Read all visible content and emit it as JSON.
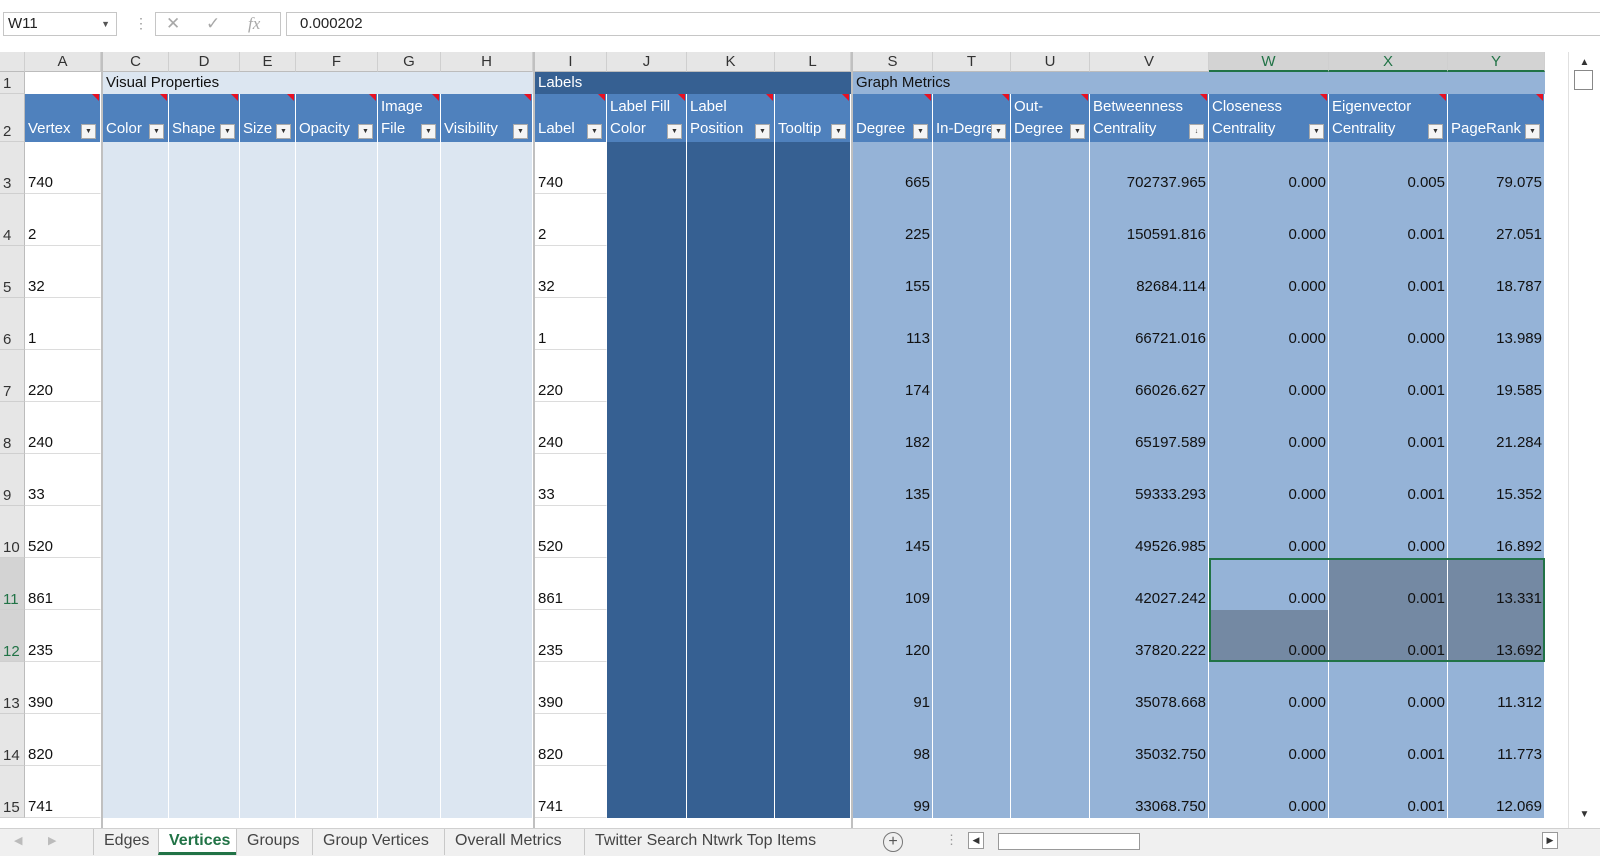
{
  "formula_bar": {
    "name_box": "W11",
    "cancel_icon": "✕",
    "enter_icon": "✓",
    "fx_label": "fx",
    "formula": "0.000202"
  },
  "columns": [
    {
      "id": "A",
      "header": "Vertex",
      "group": "vp"
    },
    {
      "id": "C",
      "header": "Color",
      "group": "vp"
    },
    {
      "id": "D",
      "header": "Shape",
      "group": "vp"
    },
    {
      "id": "E",
      "header": "Size",
      "group": "vp"
    },
    {
      "id": "F",
      "header": "Opacity",
      "group": "vp"
    },
    {
      "id": "G",
      "header": "Image\nFile",
      "group": "vp"
    },
    {
      "id": "H",
      "header": "Visibility",
      "group": "vp"
    },
    {
      "id": "I",
      "header": "Label",
      "group": "lb"
    },
    {
      "id": "J",
      "header": "Label Fill\nColor",
      "group": "lb"
    },
    {
      "id": "K",
      "header": "Label\nPosition",
      "group": "lb"
    },
    {
      "id": "L",
      "header": "Tooltip",
      "group": "lb"
    },
    {
      "id": "S",
      "header": "Degree",
      "group": "gm"
    },
    {
      "id": "T",
      "header": "In-Degree",
      "group": "gm"
    },
    {
      "id": "U",
      "header": "Out-\nDegree",
      "group": "gm"
    },
    {
      "id": "V",
      "header": "Betweenness\nCentrality",
      "group": "gm"
    },
    {
      "id": "W",
      "header": "Closeness\nCentrality",
      "group": "gm"
    },
    {
      "id": "X",
      "header": "Eigenvector\nCentrality",
      "group": "gm"
    },
    {
      "id": "Y",
      "header": "PageRank",
      "group": "gm"
    }
  ],
  "group_titles": {
    "visual_properties": "Visual Properties",
    "labels": "Labels",
    "graph_metrics": "Graph Metrics"
  },
  "row_numbers": [
    "1",
    "2",
    "3",
    "4",
    "5",
    "6",
    "7",
    "8",
    "9",
    "10",
    "11",
    "12",
    "13",
    "14",
    "15"
  ],
  "rows": [
    {
      "vertex": "740",
      "label": "740",
      "degree": "665",
      "betweenness": "702737.965",
      "closeness": "0.000",
      "eigenvector": "0.005",
      "pagerank": "79.075"
    },
    {
      "vertex": "2",
      "label": "2",
      "degree": "225",
      "betweenness": "150591.816",
      "closeness": "0.000",
      "eigenvector": "0.001",
      "pagerank": "27.051"
    },
    {
      "vertex": "32",
      "label": "32",
      "degree": "155",
      "betweenness": "82684.114",
      "closeness": "0.000",
      "eigenvector": "0.001",
      "pagerank": "18.787"
    },
    {
      "vertex": "1",
      "label": "1",
      "degree": "113",
      "betweenness": "66721.016",
      "closeness": "0.000",
      "eigenvector": "0.000",
      "pagerank": "13.989"
    },
    {
      "vertex": "220",
      "label": "220",
      "degree": "174",
      "betweenness": "66026.627",
      "closeness": "0.000",
      "eigenvector": "0.001",
      "pagerank": "19.585"
    },
    {
      "vertex": "240",
      "label": "240",
      "degree": "182",
      "betweenness": "65197.589",
      "closeness": "0.000",
      "eigenvector": "0.001",
      "pagerank": "21.284"
    },
    {
      "vertex": "33",
      "label": "33",
      "degree": "135",
      "betweenness": "59333.293",
      "closeness": "0.000",
      "eigenvector": "0.001",
      "pagerank": "15.352"
    },
    {
      "vertex": "520",
      "label": "520",
      "degree": "145",
      "betweenness": "49526.985",
      "closeness": "0.000",
      "eigenvector": "0.000",
      "pagerank": "16.892"
    },
    {
      "vertex": "861",
      "label": "861",
      "degree": "109",
      "betweenness": "42027.242",
      "closeness": "0.000",
      "eigenvector": "0.001",
      "pagerank": "13.331"
    },
    {
      "vertex": "235",
      "label": "235",
      "degree": "120",
      "betweenness": "37820.222",
      "closeness": "0.000",
      "eigenvector": "0.001",
      "pagerank": "13.692"
    },
    {
      "vertex": "390",
      "label": "390",
      "degree": "91",
      "betweenness": "35078.668",
      "closeness": "0.000",
      "eigenvector": "0.000",
      "pagerank": "11.312"
    },
    {
      "vertex": "820",
      "label": "820",
      "degree": "98",
      "betweenness": "35032.750",
      "closeness": "0.000",
      "eigenvector": "0.001",
      "pagerank": "11.773"
    },
    {
      "vertex": "741",
      "label": "741",
      "degree": "99",
      "betweenness": "33068.750",
      "closeness": "0.000",
      "eigenvector": "0.001",
      "pagerank": "12.069"
    }
  ],
  "selected": {
    "cell": "W11",
    "columns": [
      "W",
      "X",
      "Y"
    ],
    "rows": [
      "11",
      "12"
    ]
  },
  "sheet_tabs": [
    "Edges",
    "Vertices",
    "Groups",
    "Group Vertices",
    "Overall Metrics",
    "Twitter Search Ntwrk Top Items"
  ],
  "active_tab": "Vertices",
  "colors": {
    "vp": "#dce6f1",
    "lb": "#366092",
    "gm": "#95b3d7",
    "header": "#4f81bd",
    "selection": "#7489a3",
    "accent": "#217346"
  }
}
